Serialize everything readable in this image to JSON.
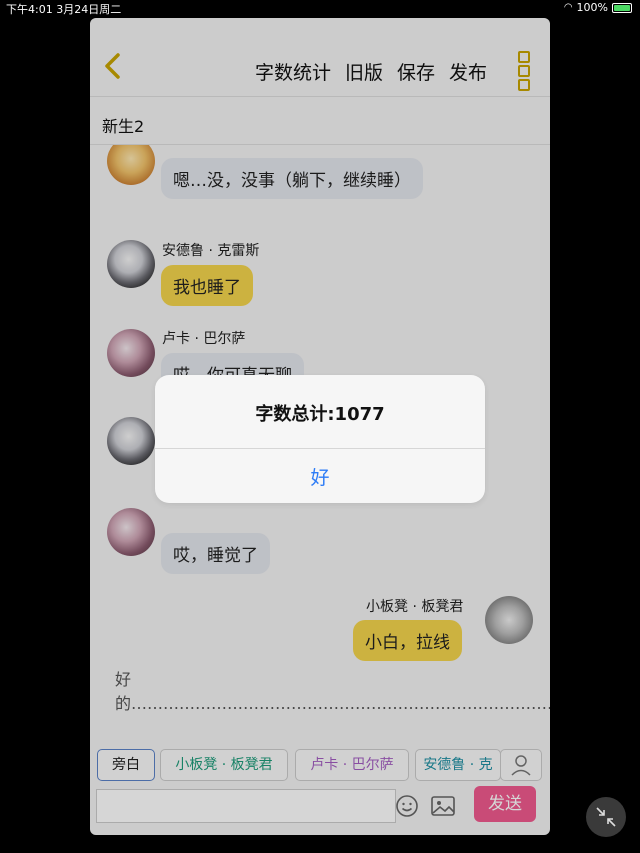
{
  "status_bar": {
    "time_date": "下午4:01  3月24日周二",
    "battery": "100%"
  },
  "toolbar": {
    "buttons": [
      "字数统计",
      "旧版",
      "保存",
      "发布"
    ]
  },
  "conversation": {
    "title": "新生2"
  },
  "messages": [
    {
      "speaker": "",
      "text": "嗯…没，没事（躺下，继续睡）"
    },
    {
      "speaker": "安德鲁 · 克雷斯",
      "text": "我也睡了"
    },
    {
      "speaker": "卢卡 · 巴尔萨",
      "text": "哎，你可真无聊"
    },
    {
      "speaker": "",
      "text": "哎，睡觉了"
    },
    {
      "speaker": "小板凳 · 板凳君",
      "text": "小白，拉线"
    }
  ],
  "draft_text": "好的…………………………………………………………………………………………",
  "roles": [
    "旁白",
    "小板凳 · 板凳君",
    "卢卡 · 巴尔萨",
    "安德鲁 · 克"
  ],
  "input": {
    "value": ""
  },
  "send_label": "发送",
  "alert": {
    "title": "字数总计:1077",
    "ok_label": "好"
  },
  "colors": {
    "accent": "#c7a400",
    "bubble_gray": "#e3e6ec",
    "bubble_yellow": "#f4d54d",
    "send": "#f05a8e",
    "alert_button": "#2d7cf6",
    "role_green": "#1e9b7a",
    "role_purple": "#a45ec2",
    "role_teal": "#1e8fa3"
  }
}
